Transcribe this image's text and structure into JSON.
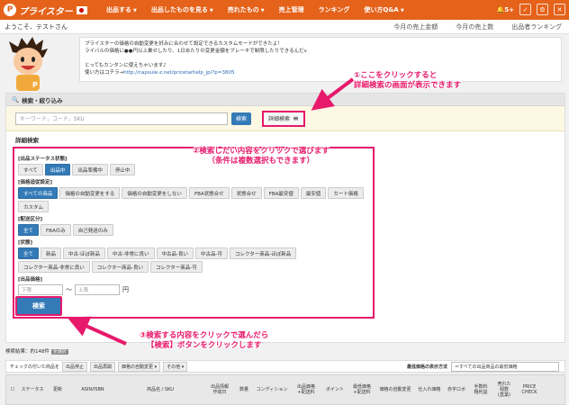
{
  "nav": {
    "logo": "プライスター",
    "items": [
      "出品する",
      "出品したものを見る",
      "売れたもの",
      "売上管理",
      "ランキング",
      "使い方Q&A"
    ],
    "badge": "5+"
  },
  "bar2": {
    "welcome": "ようこそ、テストさん",
    "links": [
      "今月の売上金額",
      "今月の売上数",
      "出品者ランキング"
    ]
  },
  "info": {
    "lines": [
      "プライスターの価格の自動変更を好みに合わせて設定できるカスタムモードができたよ！",
      "ライバルの価格に●●円以上乗せしたり、1日あたりの変更金額をブレーキで制限したりできるんだv",
      "",
      "とってもカンタンに使えちゃいます♪"
    ],
    "link_prefix": "使い方はコチラ→",
    "link": "http://capsule-z.net/pricetarhelp_jp/?p=3805"
  },
  "panel": {
    "title": "検索・絞り込み",
    "search_placeholder": "キーワード，コード，SKU",
    "search_btn": "検索",
    "detail_btn": "詳細検索",
    "detail_title": "詳細検索"
  },
  "filters": [
    {
      "label": "[出品ステータス状態]",
      "options": [
        "すべて",
        "出品中",
        "出品準備中",
        "停止中"
      ],
      "selected": 1
    },
    {
      "label": "[価格追従設定]",
      "options": [
        "すべての商品",
        "価格の自動変更をする",
        "価格の自動変更をしない",
        "FBA状態合せ",
        "状態合せ",
        "FBA最安値",
        "最安値",
        "カート価格",
        "カスタム"
      ],
      "selected": 0
    },
    {
      "label": "[配送区分]",
      "options": [
        "全て",
        "FBAのみ",
        "自己発送のみ"
      ],
      "selected": 0
    },
    {
      "label": "[状態]",
      "options": [
        "全て",
        "新品",
        "中古-ほぼ新品",
        "中古-非常に良い",
        "中古品-良い",
        "中古品-可",
        "コレクター商品-ほぼ新品",
        "コレクター商品-非常に良い",
        "コレクター商品-良い",
        "コレクター商品-可"
      ],
      "selected": 0
    }
  ],
  "price": {
    "label": "[出品価格]",
    "min": "下限",
    "max": "上限",
    "tilde": "〜",
    "unit": "円"
  },
  "search_btn": "検索",
  "annotations": {
    "a1": "①ここをクリックすると\n詳細検索の画面が表示できます",
    "a2": "②検索したい内容をクリックで選びます\n（条件は複数選択もできます）",
    "a3": "③検索する内容をクリックで選んだら\n【検索】ボタンをクリックします"
  },
  "results": {
    "label": "検索結果：約148件",
    "badge": "全選択"
  },
  "toolbar": {
    "prefix": "チェックの付いた商品を",
    "buttons": [
      "出品停止",
      "出品再開",
      "価格の自動変更 ▾",
      "その他 ▾"
    ],
    "min_label": "最低価格の表示方法",
    "min_value": "＝すべての出品商品の最低価格"
  },
  "table": {
    "headers": [
      "ステータス",
      "更新",
      "ASIN/ISBN",
      "商品名 / SKU",
      "出品情報\n作成日",
      "数量",
      "コンディション",
      "出品価格\n+配送料",
      "ポイント",
      "最低価格\n+配送料",
      "価格の自動変更",
      "仕入れ価格",
      "赤字ロボ",
      "手数料\n粗利益",
      "売れた\n個数\n(直葉)",
      "PRICE\nCHECK"
    ]
  },
  "colors": {
    "brand": "#e5621a",
    "accent": "#e6196b",
    "button": "#337ab7"
  }
}
